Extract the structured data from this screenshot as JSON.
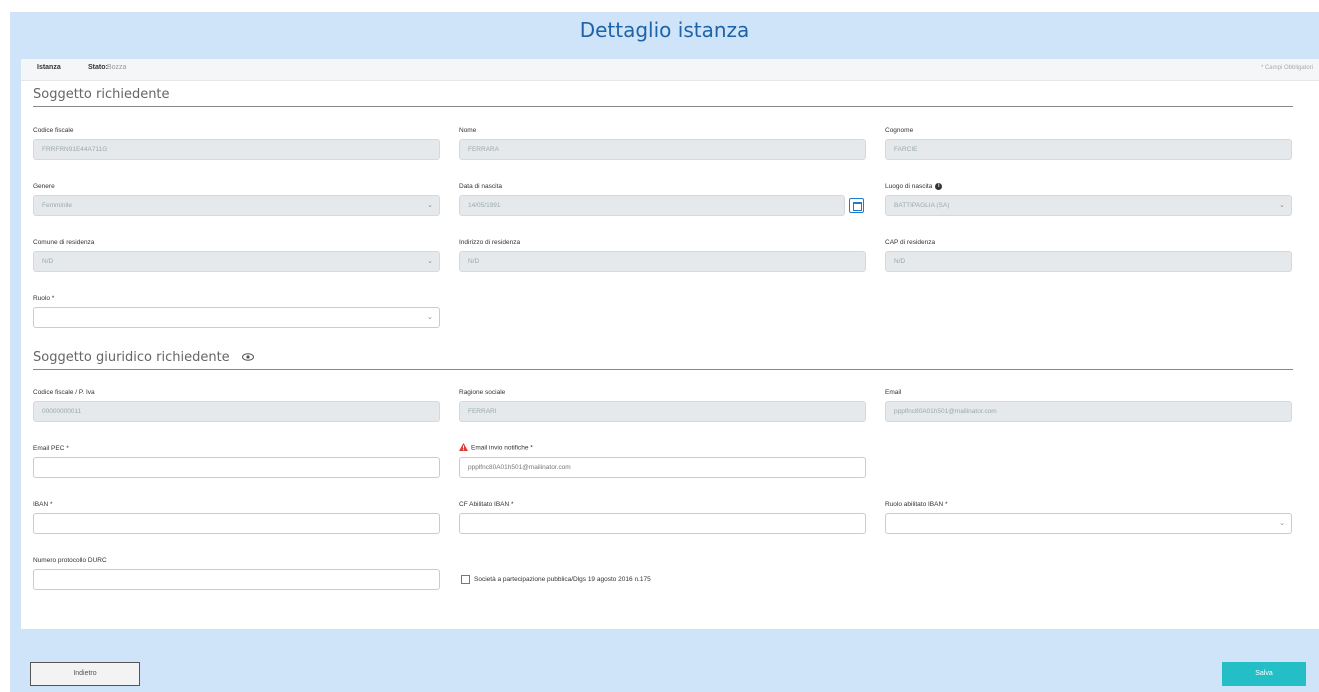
{
  "header": {
    "title": "Dettaglio istanza"
  },
  "tabs": {
    "istanza_label": "Istanza",
    "stato_label": "Stato:",
    "stato_value": "Bozza"
  },
  "required_note": "* Campi Obbligatori",
  "section1": {
    "title": "Soggetto richiedente",
    "fields": {
      "codice_fiscale": {
        "label": "Codice fiscale",
        "value": "FRRFRN91E44A711G"
      },
      "nome": {
        "label": "Nome",
        "value": "FERRARA"
      },
      "cognome": {
        "label": "Cognome",
        "value": "FARCIE"
      },
      "genere": {
        "label": "Genere",
        "value": "Femminile"
      },
      "data_nascita": {
        "label": "Data di nascita",
        "value": "14/05/1991"
      },
      "luogo_nascita": {
        "label": "Luogo di nascita",
        "value": "BATTIPAGLIA (SA)"
      },
      "comune_residenza": {
        "label": "Comune di residenza",
        "value": "N/D"
      },
      "indirizzo_residenza": {
        "label": "Indirizzo di residenza",
        "value": "N/D"
      },
      "cap_residenza": {
        "label": "CAP di residenza",
        "value": "N/D"
      },
      "ruolo": {
        "label": "Ruolo *",
        "value": ""
      }
    }
  },
  "section2": {
    "title": "Soggetto giuridico richiedente",
    "fields": {
      "codice_fiscale_piva": {
        "label": "Codice fiscale / P. Iva",
        "value": "00000000011"
      },
      "ragione_sociale": {
        "label": "Ragione sociale",
        "value": "FERRARI"
      },
      "email": {
        "label": "Email",
        "value": "ppplfnc80A01h501@mailinator.com"
      },
      "email_pec": {
        "label": "Email PEC *",
        "value": ""
      },
      "email_notifiche": {
        "label": "Email invio notifiche *",
        "value": "ppplfnc80A01h501@mailinator.com"
      },
      "iban": {
        "label": "IBAN *",
        "value": ""
      },
      "cf_abilitato_iban": {
        "label": "CF Abilitato IBAN *",
        "value": ""
      },
      "ruolo_abilitato_iban": {
        "label": "Ruolo abilitato IBAN *",
        "value": ""
      },
      "numero_protocollo_durc": {
        "label": "Numero protocollo DURC",
        "value": ""
      }
    },
    "checkbox_label": "Società a partecipazione pubblica/Dlgs 19 agosto 2016 n.175"
  },
  "footer": {
    "back_label": "Indietro",
    "save_label": "Salva"
  },
  "colors": {
    "page_bg": "#cfe4f8",
    "title": "#1e63a8",
    "save_button": "#24bfc6"
  }
}
